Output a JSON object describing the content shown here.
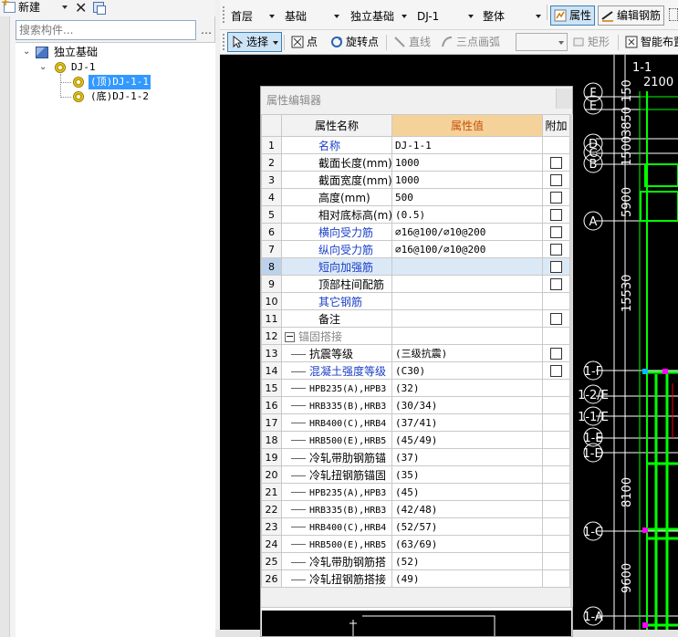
{
  "left_panel": {
    "new_label": "新建",
    "search_placeholder": "搜索构件...",
    "tree": {
      "root": "独立基础",
      "child": "DJ-1",
      "items": [
        "(顶)DJ-1-1",
        "(底)DJ-1-2"
      ]
    }
  },
  "toolbar1": {
    "floor": "首层",
    "category": "基础",
    "type": "独立基础",
    "component": "DJ-1",
    "scope": "整体",
    "property_btn": "属性",
    "edit_rebar_btn": "编辑钢筋"
  },
  "toolbar2": {
    "select": "选择",
    "point": "点",
    "rotate_point": "旋转点",
    "line": "直线",
    "arc3": "三点画弧",
    "rect": "矩形",
    "smart_layout": "智能布置"
  },
  "cad_labels": {
    "axis_letters": [
      "F",
      "E",
      "D",
      "C",
      "B",
      "A",
      "1-F",
      "1-2/E",
      "1-1/E",
      "1-E",
      "1-D",
      "1-C",
      "1-A"
    ],
    "top_text": "1-1▸",
    "top_num": "2100",
    "dims": [
      "150",
      "3850",
      "1500",
      "5900",
      "15530",
      "8100",
      "9600"
    ]
  },
  "property_editor": {
    "title": "属性编辑器",
    "headers": [
      "属性名称",
      "属性值",
      "附加"
    ],
    "rows": [
      {
        "no": "1",
        "name": "名称",
        "value": "DJ-1-1",
        "blue": true,
        "check": false
      },
      {
        "no": "2",
        "name": "截面长度(mm)",
        "value": "1000",
        "blue": false,
        "check": true
      },
      {
        "no": "3",
        "name": "截面宽度(mm)",
        "value": "1000",
        "blue": false,
        "check": true
      },
      {
        "no": "4",
        "name": "高度(mm)",
        "value": "500",
        "blue": false,
        "check": true
      },
      {
        "no": "5",
        "name": "相对底标高(m)",
        "value": "(0.5)",
        "blue": false,
        "check": true
      },
      {
        "no": "6",
        "name": "横向受力筋",
        "value": "⌀16@100/⌀10@200",
        "blue": true,
        "check": true
      },
      {
        "no": "7",
        "name": "纵向受力筋",
        "value": "⌀16@100/⌀10@200",
        "blue": true,
        "check": true
      },
      {
        "no": "8",
        "name": "短向加强筋",
        "value": "",
        "blue": true,
        "check": true,
        "highlight": true
      },
      {
        "no": "9",
        "name": "顶部柱间配筋",
        "value": "",
        "blue": false,
        "check": true
      },
      {
        "no": "10",
        "name": "其它钢筋",
        "value": "",
        "blue": true,
        "check": false
      },
      {
        "no": "11",
        "name": "备注",
        "value": "",
        "blue": false,
        "check": true
      },
      {
        "no": "12",
        "name": "锚固搭接",
        "value": "",
        "group": true,
        "check": false
      },
      {
        "no": "13",
        "name": "抗震等级",
        "value": "(三级抗震)",
        "sub": true,
        "check": true
      },
      {
        "no": "14",
        "name": "混凝土强度等级",
        "value": "(C30)",
        "sub": true,
        "blue": true,
        "check": true
      },
      {
        "no": "15",
        "name": "HPB235(A),HPB3",
        "value": "(32)",
        "sub": true,
        "mono": true,
        "check": false
      },
      {
        "no": "16",
        "name": "HRB335(B),HRB3",
        "value": "(30/34)",
        "sub": true,
        "mono": true,
        "check": false
      },
      {
        "no": "17",
        "name": "HRB400(C),HRB4",
        "value": "(37/41)",
        "sub": true,
        "mono": true,
        "check": false
      },
      {
        "no": "18",
        "name": "HRB500(E),HRB5",
        "value": "(45/49)",
        "sub": true,
        "mono": true,
        "check": false
      },
      {
        "no": "19",
        "name": "冷轧带肋钢筋锚",
        "value": "(37)",
        "sub": true,
        "check": false
      },
      {
        "no": "20",
        "name": "冷轧扭钢筋锚固",
        "value": "(35)",
        "sub": true,
        "check": false
      },
      {
        "no": "21",
        "name": "HPB235(A),HPB3",
        "value": "(45)",
        "sub": true,
        "mono": true,
        "check": false
      },
      {
        "no": "22",
        "name": "HRB335(B),HRB3",
        "value": "(42/48)",
        "sub": true,
        "mono": true,
        "check": false
      },
      {
        "no": "23",
        "name": "HRB400(C),HRB4",
        "value": "(52/57)",
        "sub": true,
        "mono": true,
        "check": false
      },
      {
        "no": "24",
        "name": "HRB500(E),HRB5",
        "value": "(63/69)",
        "sub": true,
        "mono": true,
        "check": false
      },
      {
        "no": "25",
        "name": "冷轧带肋钢筋搭",
        "value": "(52)",
        "sub": true,
        "check": false
      },
      {
        "no": "26",
        "name": "冷轧扭钢筋搭接",
        "value": "(49)",
        "sub": true,
        "check": false
      }
    ]
  },
  "colors": {
    "selection": "#3399ff",
    "header_value_bg": "#f5d29a",
    "header_value_text": "#c8500a",
    "link_blue": "#1a3fc7",
    "cad_bg": "#000000",
    "cad_green": "#00ff00"
  }
}
